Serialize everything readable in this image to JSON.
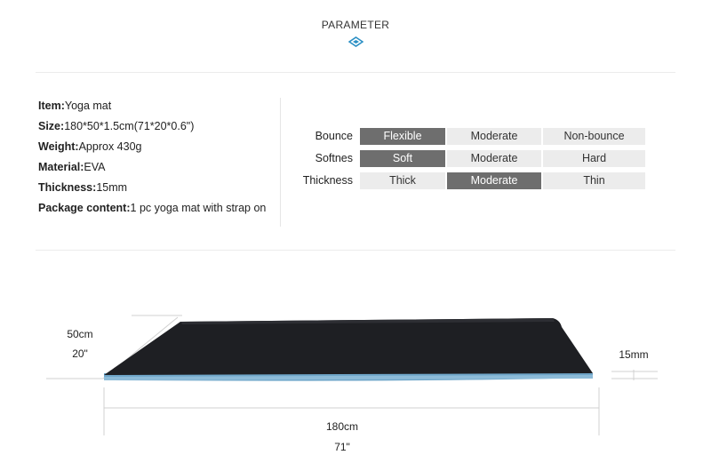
{
  "header": {
    "title": "PARAMETER"
  },
  "specs": [
    {
      "label": "Item:",
      "value": "Yoga mat"
    },
    {
      "label": "Size:",
      "value": "180*50*1.5cm(71*20*0.6\")"
    },
    {
      "label": "Weight:",
      "value": "Approx 430g"
    },
    {
      "label": "Material:",
      "value": "EVA"
    },
    {
      "label": "Thickness:",
      "value": "15mm"
    },
    {
      "label": "Package content:",
      "value": "1 pc yoga mat with strap on"
    }
  ],
  "ratings": [
    {
      "label": "Bounce",
      "options": [
        "Flexible",
        "Moderate",
        "Non-bounce"
      ],
      "selected": 0
    },
    {
      "label": "Softnes",
      "options": [
        "Soft",
        "Moderate",
        "Hard"
      ],
      "selected": 0
    },
    {
      "label": "Thickness",
      "options": [
        "Thick",
        "Moderate",
        "Thin"
      ],
      "selected": 1
    }
  ],
  "dimensions": {
    "width_cm": "50cm",
    "width_in": "20\"",
    "thickness": "15mm",
    "length_cm": "180cm",
    "length_in": "71\""
  },
  "colors": {
    "selected": "#6e6e6e",
    "unselected": "#ececec",
    "accent": "#2a8fc4",
    "mat_top": "#1e1f23",
    "mat_edge": "#6fa6c9"
  }
}
